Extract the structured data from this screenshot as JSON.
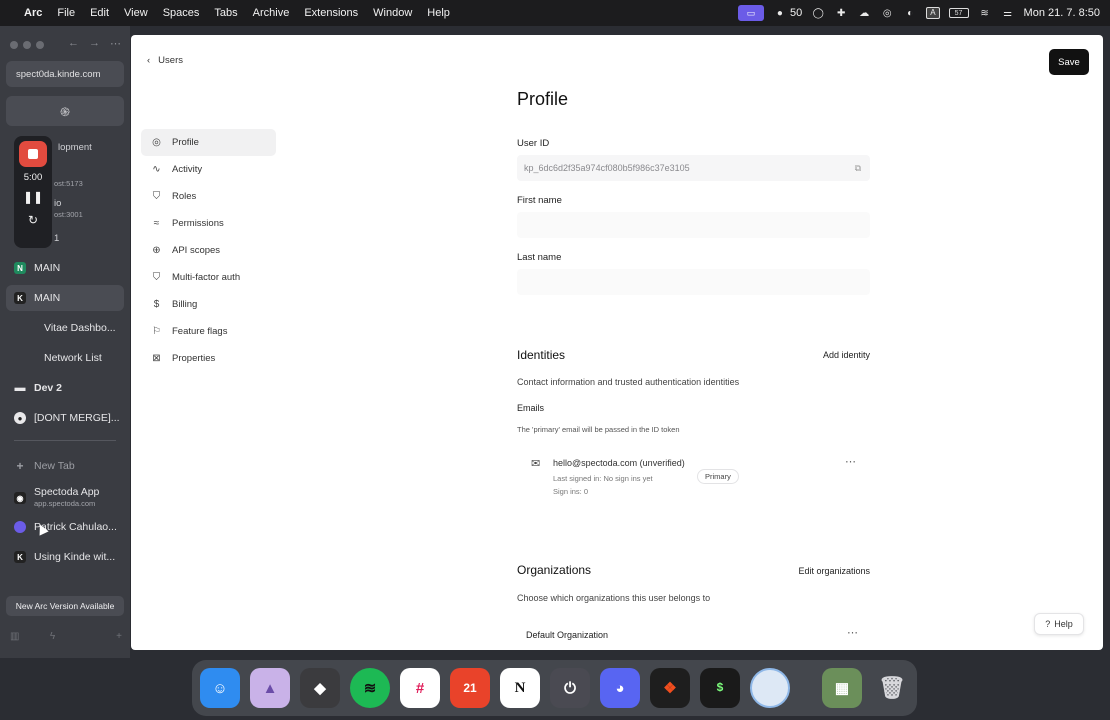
{
  "menubar": {
    "app": "Arc",
    "items": [
      "File",
      "Edit",
      "View",
      "Spaces",
      "Tabs",
      "Archive",
      "Extensions",
      "Window",
      "Help"
    ],
    "github_count": "50",
    "input_badge": "A",
    "battery": "57",
    "datetime": "Mon 21. 7.  8:50"
  },
  "sidebar": {
    "url": "spect0da.kinde.com",
    "fav_icon": "kinde-spiral-icon",
    "partial_items": [
      {
        "text": "lopment",
        "sub": ""
      },
      {
        "text": "",
        "sub": "ost:5173"
      },
      {
        "text": "io",
        "sub": "ost:3001"
      },
      {
        "text": "1",
        "sub": ""
      }
    ],
    "items": [
      {
        "label": "MAIN",
        "logo": "N",
        "color": "#1f8a5e"
      },
      {
        "label": "MAIN",
        "logo": "K",
        "color": "#222222"
      },
      {
        "label": "Vitae Dashbo...",
        "logo": "",
        "color": ""
      },
      {
        "label": "Network List",
        "logo": "",
        "color": ""
      },
      {
        "label": "Dev 2",
        "logo": "folder",
        "color": ""
      },
      {
        "label": "[DONT MERGE]...",
        "logo": "github",
        "color": ""
      }
    ],
    "new_tab": "New Tab",
    "tabs": [
      {
        "label": "Spectoda App",
        "sub": "app.spectoda.com"
      },
      {
        "label": "Patrick Cahulao...",
        "sub": ""
      },
      {
        "label": "Using Kinde wit...",
        "sub": ""
      }
    ],
    "update": "New Arc Version Available"
  },
  "recorder": {
    "time": "5:00"
  },
  "page": {
    "back": "Users",
    "save": "Save",
    "nav": [
      {
        "label": "Profile",
        "icon": "user-circle-icon"
      },
      {
        "label": "Activity",
        "icon": "activity-icon"
      },
      {
        "label": "Roles",
        "icon": "shield-icon"
      },
      {
        "label": "Permissions",
        "icon": "permissions-icon"
      },
      {
        "label": "API scopes",
        "icon": "api-scope-icon"
      },
      {
        "label": "Multi-factor auth",
        "icon": "shield-check-icon"
      },
      {
        "label": "Billing",
        "icon": "dollar-icon"
      },
      {
        "label": "Feature flags",
        "icon": "flag-icon"
      },
      {
        "label": "Properties",
        "icon": "properties-icon"
      }
    ],
    "title": "Profile",
    "user_id_label": "User ID",
    "user_id_value": "kp_6dc6d2f35a974cf080b5f986c37e3105",
    "first_name_label": "First name",
    "first_name_value": "",
    "last_name_label": "Last name",
    "last_name_value": "",
    "identities_title": "Identities",
    "add_identity": "Add identity",
    "identities_desc": "Contact information and trusted authentication identities",
    "emails_label": "Emails",
    "emails_desc": "The 'primary' email will be passed in the ID token",
    "email": {
      "address": "hello@spectoda.com (unverified)",
      "last_signed": "Last signed in: No sign ins yet",
      "sign_ins": "Sign ins: 0",
      "badge": "Primary"
    },
    "orgs_title": "Organizations",
    "edit_orgs": "Edit organizations",
    "orgs_desc": "Choose which organizations this user belongs to",
    "org_name": "Default Organization",
    "help": "Help"
  },
  "dock": [
    {
      "name": "finder",
      "color": "#2f8cf0"
    },
    {
      "name": "affinity",
      "color": "#c9b2e8"
    },
    {
      "name": "cube-app",
      "color": "#3b3b3e"
    },
    {
      "name": "spotify",
      "color": "#1db954"
    },
    {
      "name": "slack",
      "color": "#ffffff"
    },
    {
      "name": "calendar",
      "color": "#e9432a",
      "text": "21"
    },
    {
      "name": "notion",
      "color": "#ffffff",
      "text": "N"
    },
    {
      "name": "power-app",
      "color": "#4a4a52"
    },
    {
      "name": "discord",
      "color": "#5865f2"
    },
    {
      "name": "figma",
      "color": "#1e1e1e"
    },
    {
      "name": "terminal",
      "color": "#1a1a1a",
      "text": "$"
    },
    {
      "name": "circle-app",
      "color": "#dde8f5"
    }
  ]
}
